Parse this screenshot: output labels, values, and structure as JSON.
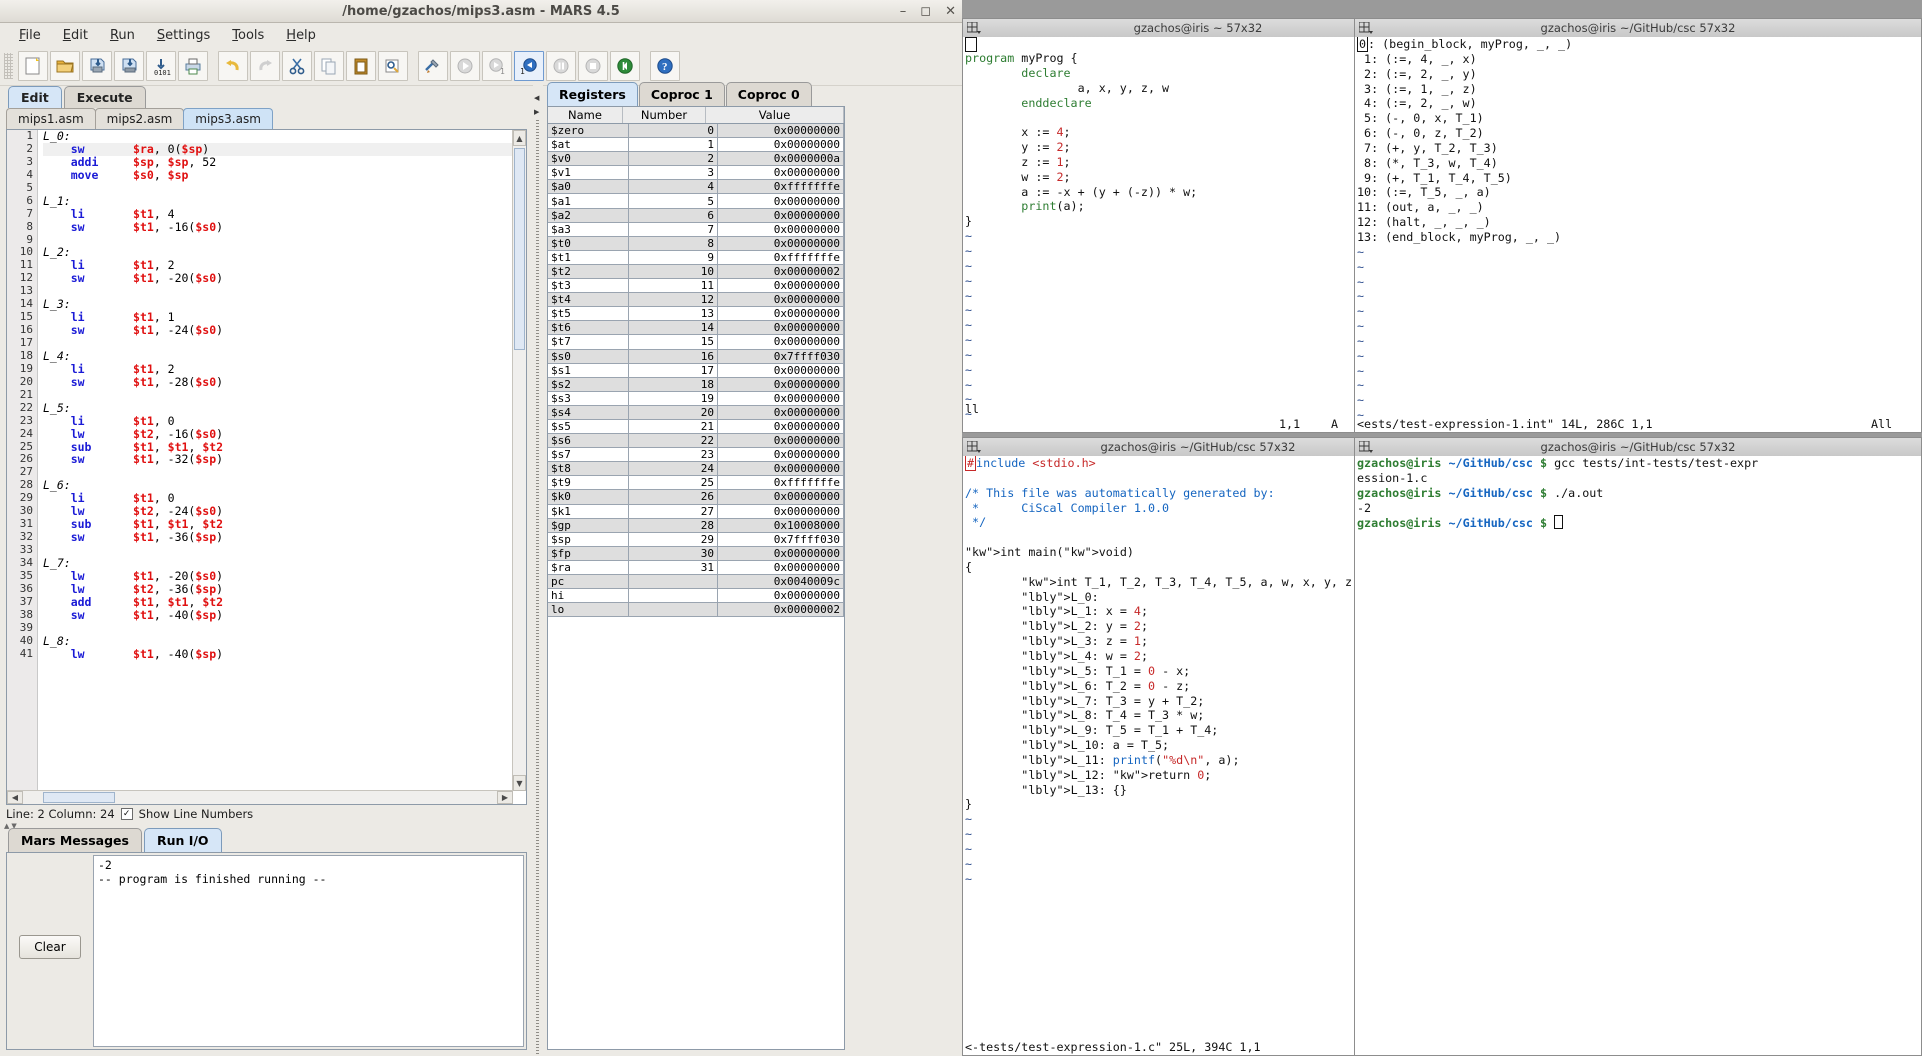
{
  "mars": {
    "title": "/home/gzachos/mips3.asm  - MARS 4.5",
    "window_buttons": [
      "minimize",
      "maximize",
      "close"
    ],
    "menus": [
      "File",
      "Edit",
      "Run",
      "Settings",
      "Tools",
      "Help"
    ],
    "toolbar_icons": [
      "new-file-icon",
      "open-folder-icon",
      "save-icon",
      "save-as-icon",
      "dump-memory-icon",
      "print-icon",
      "undo-icon",
      "redo-icon",
      "cut-icon",
      "copy-icon",
      "paste-icon",
      "find-replace-icon",
      "assemble-icon",
      "run-icon",
      "step-icon",
      "step-back-icon",
      "pause-icon",
      "stop-icon",
      "reset-icon",
      "help-icon"
    ],
    "main_tabs": [
      {
        "label": "Edit",
        "selected": true
      },
      {
        "label": "Execute",
        "selected": false
      }
    ],
    "file_tabs": [
      {
        "label": "mips1.asm",
        "selected": false
      },
      {
        "label": "mips2.asm",
        "selected": false
      },
      {
        "label": "mips3.asm",
        "selected": true
      }
    ],
    "editor_lines": [
      {
        "n": 1,
        "label": "L_0:",
        "op": "",
        "args": ""
      },
      {
        "n": 2,
        "label": "",
        "op": "sw",
        "args": "$ra, 0($sp)",
        "current": true
      },
      {
        "n": 3,
        "label": "",
        "op": "addi",
        "args": "$sp, $sp, 52"
      },
      {
        "n": 4,
        "label": "",
        "op": "move",
        "args": "$s0, $sp"
      },
      {
        "n": 5,
        "label": "",
        "op": "",
        "args": ""
      },
      {
        "n": 6,
        "label": "L_1:",
        "op": "",
        "args": ""
      },
      {
        "n": 7,
        "label": "",
        "op": "li",
        "args": "$t1, 4"
      },
      {
        "n": 8,
        "label": "",
        "op": "sw",
        "args": "$t1, -16($s0)"
      },
      {
        "n": 9,
        "label": "",
        "op": "",
        "args": ""
      },
      {
        "n": 10,
        "label": "L_2:",
        "op": "",
        "args": ""
      },
      {
        "n": 11,
        "label": "",
        "op": "li",
        "args": "$t1, 2"
      },
      {
        "n": 12,
        "label": "",
        "op": "sw",
        "args": "$t1, -20($s0)"
      },
      {
        "n": 13,
        "label": "",
        "op": "",
        "args": ""
      },
      {
        "n": 14,
        "label": "L_3:",
        "op": "",
        "args": ""
      },
      {
        "n": 15,
        "label": "",
        "op": "li",
        "args": "$t1, 1"
      },
      {
        "n": 16,
        "label": "",
        "op": "sw",
        "args": "$t1, -24($s0)"
      },
      {
        "n": 17,
        "label": "",
        "op": "",
        "args": ""
      },
      {
        "n": 18,
        "label": "L_4:",
        "op": "",
        "args": ""
      },
      {
        "n": 19,
        "label": "",
        "op": "li",
        "args": "$t1, 2"
      },
      {
        "n": 20,
        "label": "",
        "op": "sw",
        "args": "$t1, -28($s0)"
      },
      {
        "n": 21,
        "label": "",
        "op": "",
        "args": ""
      },
      {
        "n": 22,
        "label": "L_5:",
        "op": "",
        "args": ""
      },
      {
        "n": 23,
        "label": "",
        "op": "li",
        "args": "$t1, 0"
      },
      {
        "n": 24,
        "label": "",
        "op": "lw",
        "args": "$t2, -16($s0)"
      },
      {
        "n": 25,
        "label": "",
        "op": "sub",
        "args": "$t1, $t1, $t2"
      },
      {
        "n": 26,
        "label": "",
        "op": "sw",
        "args": "$t1, -32($sp)"
      },
      {
        "n": 27,
        "label": "",
        "op": "",
        "args": ""
      },
      {
        "n": 28,
        "label": "L_6:",
        "op": "",
        "args": ""
      },
      {
        "n": 29,
        "label": "",
        "op": "li",
        "args": "$t1, 0"
      },
      {
        "n": 30,
        "label": "",
        "op": "lw",
        "args": "$t2, -24($s0)"
      },
      {
        "n": 31,
        "label": "",
        "op": "sub",
        "args": "$t1, $t1, $t2"
      },
      {
        "n": 32,
        "label": "",
        "op": "sw",
        "args": "$t1, -36($sp)"
      },
      {
        "n": 33,
        "label": "",
        "op": "",
        "args": ""
      },
      {
        "n": 34,
        "label": "L_7:",
        "op": "",
        "args": ""
      },
      {
        "n": 35,
        "label": "",
        "op": "lw",
        "args": "$t1, -20($s0)"
      },
      {
        "n": 36,
        "label": "",
        "op": "lw",
        "args": "$t2, -36($sp)"
      },
      {
        "n": 37,
        "label": "",
        "op": "add",
        "args": "$t1, $t1, $t2"
      },
      {
        "n": 38,
        "label": "",
        "op": "sw",
        "args": "$t1, -40($sp)"
      },
      {
        "n": 39,
        "label": "",
        "op": "",
        "args": ""
      },
      {
        "n": 40,
        "label": "L_8:",
        "op": "",
        "args": ""
      },
      {
        "n": 41,
        "label": "",
        "op": "lw",
        "args": "$t1, -40($sp)"
      }
    ],
    "status": {
      "text": "Line: 2 Column: 24",
      "show_line_numbers": "Show Line Numbers",
      "checked": true
    },
    "message_tabs": [
      {
        "label": "Mars Messages",
        "selected": false
      },
      {
        "label": "Run I/O",
        "selected": true
      }
    ],
    "run_io": [
      "-2",
      "-- program is finished running --"
    ],
    "clear_button": "Clear"
  },
  "registers": {
    "tabs": [
      {
        "label": "Registers",
        "selected": true
      },
      {
        "label": "Coproc 1",
        "selected": false
      },
      {
        "label": "Coproc 0",
        "selected": false
      }
    ],
    "columns": [
      "Name",
      "Number",
      "Value"
    ],
    "rows": [
      {
        "name": "$zero",
        "number": "0",
        "value": "0x00000000"
      },
      {
        "name": "$at",
        "number": "1",
        "value": "0x00000000"
      },
      {
        "name": "$v0",
        "number": "2",
        "value": "0x0000000a"
      },
      {
        "name": "$v1",
        "number": "3",
        "value": "0x00000000"
      },
      {
        "name": "$a0",
        "number": "4",
        "value": "0xfffffffe"
      },
      {
        "name": "$a1",
        "number": "5",
        "value": "0x00000000"
      },
      {
        "name": "$a2",
        "number": "6",
        "value": "0x00000000"
      },
      {
        "name": "$a3",
        "number": "7",
        "value": "0x00000000"
      },
      {
        "name": "$t0",
        "number": "8",
        "value": "0x00000000"
      },
      {
        "name": "$t1",
        "number": "9",
        "value": "0xfffffffe"
      },
      {
        "name": "$t2",
        "number": "10",
        "value": "0x00000002"
      },
      {
        "name": "$t3",
        "number": "11",
        "value": "0x00000000"
      },
      {
        "name": "$t4",
        "number": "12",
        "value": "0x00000000"
      },
      {
        "name": "$t5",
        "number": "13",
        "value": "0x00000000"
      },
      {
        "name": "$t6",
        "number": "14",
        "value": "0x00000000"
      },
      {
        "name": "$t7",
        "number": "15",
        "value": "0x00000000"
      },
      {
        "name": "$s0",
        "number": "16",
        "value": "0x7ffff030"
      },
      {
        "name": "$s1",
        "number": "17",
        "value": "0x00000000"
      },
      {
        "name": "$s2",
        "number": "18",
        "value": "0x00000000"
      },
      {
        "name": "$s3",
        "number": "19",
        "value": "0x00000000"
      },
      {
        "name": "$s4",
        "number": "20",
        "value": "0x00000000"
      },
      {
        "name": "$s5",
        "number": "21",
        "value": "0x00000000"
      },
      {
        "name": "$s6",
        "number": "22",
        "value": "0x00000000"
      },
      {
        "name": "$s7",
        "number": "23",
        "value": "0x00000000"
      },
      {
        "name": "$t8",
        "number": "24",
        "value": "0x00000000"
      },
      {
        "name": "$t9",
        "number": "25",
        "value": "0xfffffffe"
      },
      {
        "name": "$k0",
        "number": "26",
        "value": "0x00000000"
      },
      {
        "name": "$k1",
        "number": "27",
        "value": "0x00000000"
      },
      {
        "name": "$gp",
        "number": "28",
        "value": "0x10008000"
      },
      {
        "name": "$sp",
        "number": "29",
        "value": "0x7ffff030"
      },
      {
        "name": "$fp",
        "number": "30",
        "value": "0x00000000"
      },
      {
        "name": "$ra",
        "number": "31",
        "value": "0x00000000"
      },
      {
        "name": "pc",
        "number": "",
        "value": "0x0040009c"
      },
      {
        "name": "hi",
        "number": "",
        "value": "0x00000000"
      },
      {
        "name": "lo",
        "number": "",
        "value": "0x00000002"
      }
    ]
  },
  "terminals": {
    "source": {
      "title": "gzachos@iris ~ 57x32",
      "lines": [
        "program myProg {",
        "        declare",
        "                a, x, y, z, w",
        "        enddeclare",
        "",
        "        x := 4;",
        "        y := 2;",
        "        z := 1;",
        "        w := 2;",
        "        a := -x + (y + (-z)) * w;",
        "        print(a);",
        "}"
      ],
      "tilde_count": 18,
      "mode": "ll",
      "status_pos": "1,1",
      "status_pct": "A"
    },
    "intermediate": {
      "title": "gzachos@iris ~/GitHub/csc 57x32",
      "lines": [
        " 0: (begin_block, myProg, _, _)",
        " 1: (:=, 4, _, x)",
        " 2: (:=, 2, _, y)",
        " 3: (:=, 1, _, z)",
        " 4: (:=, 2, _, w)",
        " 5: (-, 0, x, T_1)",
        " 6: (-, 0, z, T_2)",
        " 7: (+, y, T_2, T_3)",
        " 8: (*, T_3, w, T_4)",
        " 9: (+, T_1, T_4, T_5)",
        "10: (:=, T_5, _, a)",
        "11: (out, a, _, _)",
        "12: (halt, _, _, _)",
        "13: (end_block, myProg, _, _)"
      ],
      "tilde_count": 16,
      "status_file": "<ests/test-expression-1.int\" 14L, 286C 1,1",
      "status_pct": "All"
    },
    "cfile": {
      "title": "gzachos@iris ~/GitHub/csc 57x32",
      "lines": [
        "#include <stdio.h>",
        "",
        "/* This file was automatically generated by:",
        " *      CiScal Compiler 1.0.0",
        " */",
        "",
        "int main(void)",
        "{",
        "        int T_1, T_2, T_3, T_4, T_5, a, w, x, y, z;",
        "        L_0:",
        "        L_1: x = 4;",
        "        L_2: y = 2;",
        "        L_3: z = 1;",
        "        L_4: w = 2;",
        "        L_5: T_1 = 0 - x;",
        "        L_6: T_2 = 0 - z;",
        "        L_7: T_3 = y + T_2;",
        "        L_8: T_4 = T_3 * w;",
        "        L_9: T_5 = T_1 + T_4;",
        "        L_10: a = T_5;",
        "        L_11: printf(\"%d\\n\", a);",
        "        L_12: return 0;",
        "        L_13: {}",
        "}"
      ],
      "tilde_count": 5,
      "status_file": "<-tests/test-expression-1.c\" 25L, 394C 1,1",
      "status_pct": "All"
    },
    "shell": {
      "title": "gzachos@iris ~/GitHub/csc 57x32",
      "lines": [
        {
          "user": "gzachos@iris",
          "path": "~/GitHub/csc",
          "prompt": "$",
          "cmd": "gcc tests/int-tests/test-expr"
        },
        {
          "cont": "ession-1.c"
        },
        {
          "user": "gzachos@iris",
          "path": "~/GitHub/csc",
          "prompt": "$",
          "cmd": "./a.out"
        },
        {
          "plain": "-2"
        },
        {
          "user": "gzachos@iris",
          "path": "~/GitHub/csc",
          "prompt": "$",
          "cmd": ""
        }
      ]
    }
  },
  "colors": {
    "accent": "#d6e6f7",
    "register_red": "#e01010",
    "opcode_blue": "#1a1ad6",
    "prompt_green": "#2e7d32",
    "prompt_blue": "#1565c0"
  }
}
